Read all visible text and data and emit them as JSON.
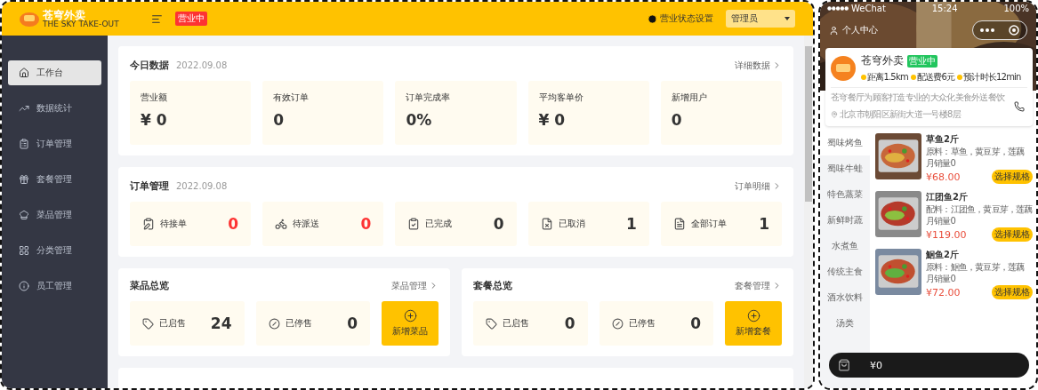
{
  "admin": {
    "header": {
      "logo_title": "苍穹外卖",
      "logo_subtitle": "THE SKY TAKE-OUT",
      "status_badge": "营业中",
      "status_setting": "营业状态设置",
      "user": "管理员"
    },
    "sidebar": {
      "items": [
        {
          "label": "工作台",
          "selected": true
        },
        {
          "label": "数据统计",
          "selected": false
        },
        {
          "label": "订单管理",
          "selected": false
        },
        {
          "label": "套餐管理",
          "selected": false
        },
        {
          "label": "菜品管理",
          "selected": false
        },
        {
          "label": "分类管理",
          "selected": false
        },
        {
          "label": "员工管理",
          "selected": false
        }
      ]
    },
    "today": {
      "title": "今日数据",
      "date": "2022.09.08",
      "link": "详细数据",
      "stats": [
        {
          "label": "营业额",
          "value": "¥ 0"
        },
        {
          "label": "有效订单",
          "value": "0"
        },
        {
          "label": "订单完成率",
          "value": "0%"
        },
        {
          "label": "平均客单价",
          "value": "¥ 0"
        },
        {
          "label": "新增用户",
          "value": "0"
        }
      ]
    },
    "orders": {
      "title": "订单管理",
      "date": "2022.09.08",
      "link": "订单明细",
      "stats": [
        {
          "label": "待接单",
          "value": "0",
          "alert": true
        },
        {
          "label": "待派送",
          "value": "0",
          "alert": true
        },
        {
          "label": "已完成",
          "value": "0",
          "alert": false
        },
        {
          "label": "已取消",
          "value": "1",
          "alert": false
        },
        {
          "label": "全部订单",
          "value": "1",
          "alert": false
        }
      ]
    },
    "overviews": [
      {
        "title": "菜品总览",
        "link": "菜品管理",
        "stats": [
          {
            "label": "已启售",
            "value": "24"
          },
          {
            "label": "已停售",
            "value": "0"
          }
        ],
        "add_button": "新增菜品"
      },
      {
        "title": "套餐总览",
        "link": "套餐管理",
        "stats": [
          {
            "label": "已启售",
            "value": "0"
          },
          {
            "label": "已停售",
            "value": "0"
          }
        ],
        "add_button": "新增套餐"
      }
    ]
  },
  "phone": {
    "status_bar": {
      "carrier": "WeChat",
      "time": "15:24",
      "battery": "100%"
    },
    "profile_link": "个人中心",
    "store": {
      "name": "苍穹外卖",
      "status": "营业中",
      "info": [
        "距离1.5km",
        "配送费6元",
        "预计时长12min"
      ],
      "description": "苍穹餐厅为顾客打造专业的大众化美食外送餐饮",
      "address": "北京市朝阳区新街大道一号楼8层"
    },
    "categories": [
      {
        "label": "蜀味烤鱼",
        "selected": true
      },
      {
        "label": "蜀味牛蛙",
        "selected": false
      },
      {
        "label": "特色蒸菜",
        "selected": false
      },
      {
        "label": "新鲜时蔬",
        "selected": false
      },
      {
        "label": "水煮鱼",
        "selected": false
      },
      {
        "label": "传统主食",
        "selected": false
      },
      {
        "label": "酒水饮料",
        "selected": false
      },
      {
        "label": "汤类",
        "selected": false
      }
    ],
    "dishes": [
      {
        "name": "草鱼2斤",
        "ingredients": "原料：草鱼，黄豆芽，莲藕",
        "sales": "月销量0",
        "price": "¥68.00",
        "button": "选择规格"
      },
      {
        "name": "江团鱼2斤",
        "ingredients": "配料：江团鱼，黄豆芽，莲藕",
        "sales": "月销量0",
        "price": "¥119.00",
        "button": "选择规格"
      },
      {
        "name": "鮰鱼2斤",
        "ingredients": "原料：鮰鱼，黄豆芽，莲藕",
        "sales": "月销量0",
        "price": "¥72.00",
        "button": "选择规格"
      }
    ],
    "cart": {
      "total": "¥0"
    }
  }
}
